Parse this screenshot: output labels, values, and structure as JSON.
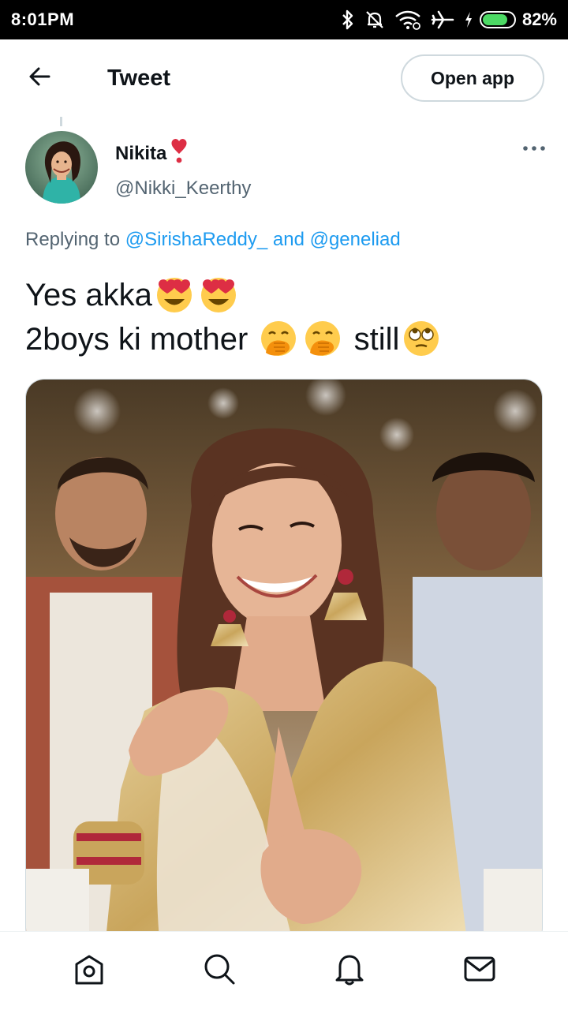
{
  "status_bar": {
    "time": "8:01PM",
    "battery_percent": "82%",
    "battery_level": 0.82,
    "icons": [
      "bluetooth-icon",
      "mute-icon",
      "wifi-icon",
      "airplane-icon",
      "charging-icon",
      "battery-icon"
    ]
  },
  "header": {
    "title": "Tweet",
    "open_app_label": "Open app",
    "back_icon": "arrow-left-icon"
  },
  "tweet": {
    "author_name": "Nikita",
    "author_badge_emoji": "heart-exclamation",
    "author_handle": "@Nikki_Keerthy",
    "more_icon": "more-horizontal-icon",
    "replying_prefix": "Replying to",
    "reply_mention_1": "@SirishaReddy_",
    "reply_joiner": "and",
    "reply_mention_2": "@geneliad",
    "line1_text": "Yes akka",
    "line1_emojis": [
      "heart-eyes-emoji",
      "heart-eyes-emoji"
    ],
    "line2_text_a": "2boys ki mother",
    "line2_emojis": [
      "hand-over-mouth-emoji",
      "hand-over-mouth-emoji"
    ],
    "line2_text_b": "still",
    "line2_end_emoji": "rolling-eyes-emoji"
  },
  "bottom_nav": {
    "items": [
      "home-icon",
      "search-icon",
      "notifications-icon",
      "messages-icon"
    ]
  },
  "colors": {
    "link": "#1d9bf0",
    "secondary_text": "#536471",
    "border": "#cfd9de",
    "status_bar_bg": "#000000",
    "battery_fill": "#4cd964"
  }
}
